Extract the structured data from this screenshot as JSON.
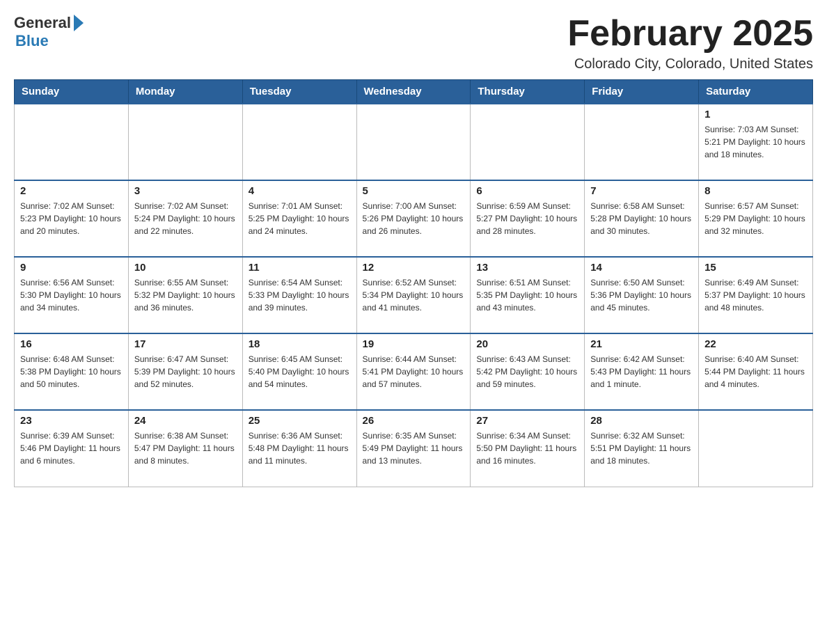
{
  "logo": {
    "general": "General",
    "blue": "Blue"
  },
  "title": {
    "month": "February 2025",
    "location": "Colorado City, Colorado, United States"
  },
  "weekdays": [
    "Sunday",
    "Monday",
    "Tuesday",
    "Wednesday",
    "Thursday",
    "Friday",
    "Saturday"
  ],
  "weeks": [
    [
      {
        "day": "",
        "info": ""
      },
      {
        "day": "",
        "info": ""
      },
      {
        "day": "",
        "info": ""
      },
      {
        "day": "",
        "info": ""
      },
      {
        "day": "",
        "info": ""
      },
      {
        "day": "",
        "info": ""
      },
      {
        "day": "1",
        "info": "Sunrise: 7:03 AM\nSunset: 5:21 PM\nDaylight: 10 hours and 18 minutes."
      }
    ],
    [
      {
        "day": "2",
        "info": "Sunrise: 7:02 AM\nSunset: 5:23 PM\nDaylight: 10 hours and 20 minutes."
      },
      {
        "day": "3",
        "info": "Sunrise: 7:02 AM\nSunset: 5:24 PM\nDaylight: 10 hours and 22 minutes."
      },
      {
        "day": "4",
        "info": "Sunrise: 7:01 AM\nSunset: 5:25 PM\nDaylight: 10 hours and 24 minutes."
      },
      {
        "day": "5",
        "info": "Sunrise: 7:00 AM\nSunset: 5:26 PM\nDaylight: 10 hours and 26 minutes."
      },
      {
        "day": "6",
        "info": "Sunrise: 6:59 AM\nSunset: 5:27 PM\nDaylight: 10 hours and 28 minutes."
      },
      {
        "day": "7",
        "info": "Sunrise: 6:58 AM\nSunset: 5:28 PM\nDaylight: 10 hours and 30 minutes."
      },
      {
        "day": "8",
        "info": "Sunrise: 6:57 AM\nSunset: 5:29 PM\nDaylight: 10 hours and 32 minutes."
      }
    ],
    [
      {
        "day": "9",
        "info": "Sunrise: 6:56 AM\nSunset: 5:30 PM\nDaylight: 10 hours and 34 minutes."
      },
      {
        "day": "10",
        "info": "Sunrise: 6:55 AM\nSunset: 5:32 PM\nDaylight: 10 hours and 36 minutes."
      },
      {
        "day": "11",
        "info": "Sunrise: 6:54 AM\nSunset: 5:33 PM\nDaylight: 10 hours and 39 minutes."
      },
      {
        "day": "12",
        "info": "Sunrise: 6:52 AM\nSunset: 5:34 PM\nDaylight: 10 hours and 41 minutes."
      },
      {
        "day": "13",
        "info": "Sunrise: 6:51 AM\nSunset: 5:35 PM\nDaylight: 10 hours and 43 minutes."
      },
      {
        "day": "14",
        "info": "Sunrise: 6:50 AM\nSunset: 5:36 PM\nDaylight: 10 hours and 45 minutes."
      },
      {
        "day": "15",
        "info": "Sunrise: 6:49 AM\nSunset: 5:37 PM\nDaylight: 10 hours and 48 minutes."
      }
    ],
    [
      {
        "day": "16",
        "info": "Sunrise: 6:48 AM\nSunset: 5:38 PM\nDaylight: 10 hours and 50 minutes."
      },
      {
        "day": "17",
        "info": "Sunrise: 6:47 AM\nSunset: 5:39 PM\nDaylight: 10 hours and 52 minutes."
      },
      {
        "day": "18",
        "info": "Sunrise: 6:45 AM\nSunset: 5:40 PM\nDaylight: 10 hours and 54 minutes."
      },
      {
        "day": "19",
        "info": "Sunrise: 6:44 AM\nSunset: 5:41 PM\nDaylight: 10 hours and 57 minutes."
      },
      {
        "day": "20",
        "info": "Sunrise: 6:43 AM\nSunset: 5:42 PM\nDaylight: 10 hours and 59 minutes."
      },
      {
        "day": "21",
        "info": "Sunrise: 6:42 AM\nSunset: 5:43 PM\nDaylight: 11 hours and 1 minute."
      },
      {
        "day": "22",
        "info": "Sunrise: 6:40 AM\nSunset: 5:44 PM\nDaylight: 11 hours and 4 minutes."
      }
    ],
    [
      {
        "day": "23",
        "info": "Sunrise: 6:39 AM\nSunset: 5:46 PM\nDaylight: 11 hours and 6 minutes."
      },
      {
        "day": "24",
        "info": "Sunrise: 6:38 AM\nSunset: 5:47 PM\nDaylight: 11 hours and 8 minutes."
      },
      {
        "day": "25",
        "info": "Sunrise: 6:36 AM\nSunset: 5:48 PM\nDaylight: 11 hours and 11 minutes."
      },
      {
        "day": "26",
        "info": "Sunrise: 6:35 AM\nSunset: 5:49 PM\nDaylight: 11 hours and 13 minutes."
      },
      {
        "day": "27",
        "info": "Sunrise: 6:34 AM\nSunset: 5:50 PM\nDaylight: 11 hours and 16 minutes."
      },
      {
        "day": "28",
        "info": "Sunrise: 6:32 AM\nSunset: 5:51 PM\nDaylight: 11 hours and 18 minutes."
      },
      {
        "day": "",
        "info": ""
      }
    ]
  ]
}
